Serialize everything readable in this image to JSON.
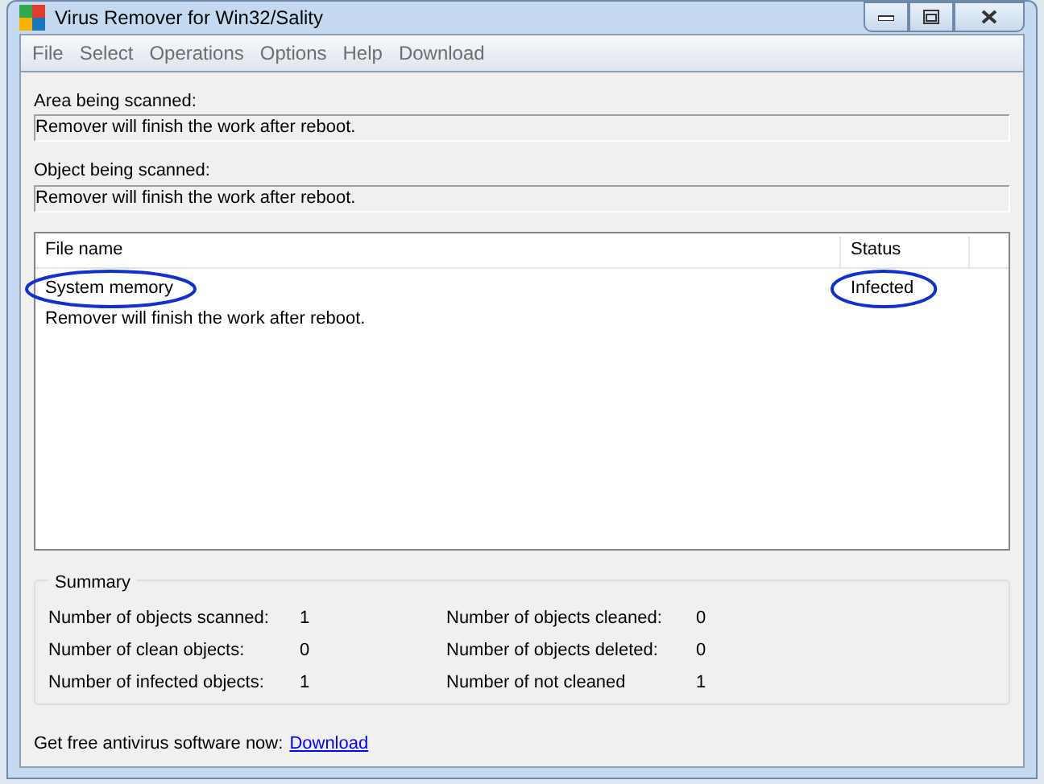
{
  "window": {
    "title": "Virus Remover for Win32/Sality"
  },
  "menu": [
    "File",
    "Select",
    "Operations",
    "Options",
    "Help",
    "Download"
  ],
  "fields": [
    {
      "label": "Area being scanned:",
      "value": "Remover will finish the work after reboot."
    },
    {
      "label": "Object being scanned:",
      "value": "Remover will finish the work after reboot."
    }
  ],
  "table": {
    "columns": [
      "File name",
      "Status"
    ],
    "rows": [
      {
        "file_name": "System memory",
        "status": "Infected",
        "note": "Remover will finish the work after reboot.",
        "circled": true
      }
    ]
  },
  "summary": {
    "title": "Summary",
    "left": [
      {
        "label": "Number of objects scanned:",
        "value": "1"
      },
      {
        "label": "Number of clean objects:",
        "value": "0"
      },
      {
        "label": "Number of infected objects:",
        "value": "1"
      }
    ],
    "right": [
      {
        "label": "Number of objects cleaned:",
        "value": "0"
      },
      {
        "label": "Number of objects deleted:",
        "value": "0"
      },
      {
        "label": "Number of not cleaned",
        "value": "1"
      }
    ]
  },
  "footer": {
    "text": "Get free antivirus software now:",
    "link": "Download"
  }
}
